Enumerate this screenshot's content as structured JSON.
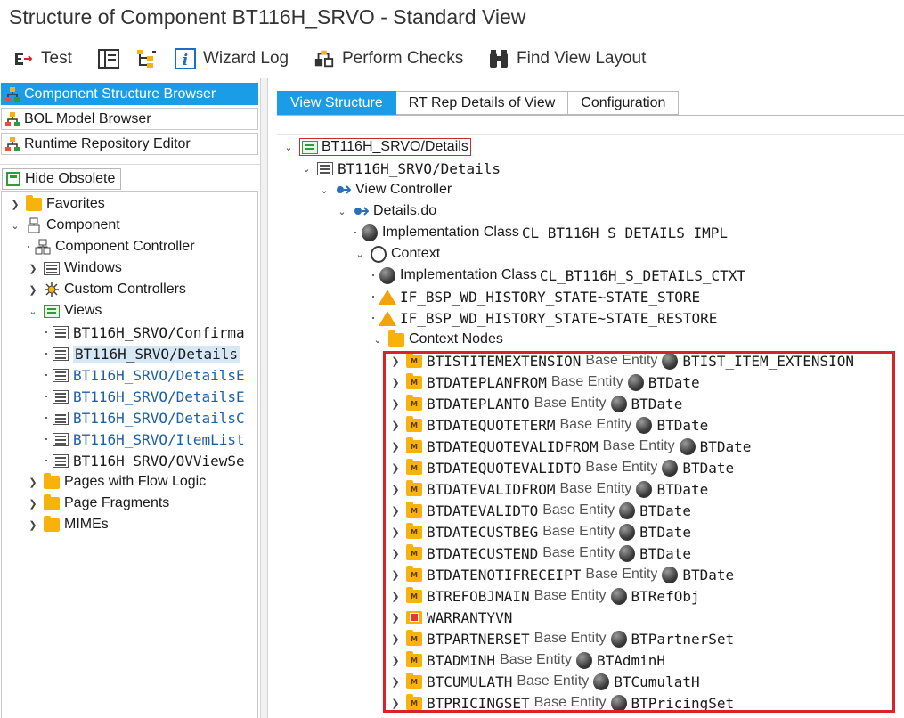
{
  "window": {
    "title": "Structure of Component BT116H_SRVO - Standard View"
  },
  "toolbar": {
    "test_label": "Test",
    "wizard_log_label": "Wizard Log",
    "perform_checks_label": "Perform Checks",
    "find_view_layout_label": "Find View Layout"
  },
  "left_panel": {
    "browsers": [
      {
        "label": "Component Structure Browser"
      },
      {
        "label": "BOL Model Browser"
      },
      {
        "label": "Runtime Repository Editor"
      }
    ],
    "hide_obsolete_label": "Hide Obsolete",
    "tree": {
      "favorites": "Favorites",
      "component": "Component",
      "component_controller": "Component Controller",
      "windows": "Windows",
      "custom_controllers": "Custom Controllers",
      "views": "Views",
      "view_items": [
        "BT116H_SRVO/Confirma",
        "BT116H_SRVO/Details",
        "BT116H_SRVO/DetailsE",
        "BT116H_SRVO/DetailsE",
        "BT116H_SRVO/DetailsC",
        "BT116H_SRVO/ItemList",
        "BT116H_SRVO/OVViewSe"
      ],
      "pages_with_flow_logic": "Pages with Flow Logic",
      "page_fragments": "Page Fragments",
      "mimes": "MIMEs"
    }
  },
  "tabs": [
    {
      "label": "View Structure"
    },
    {
      "label": "RT Rep Details of View"
    },
    {
      "label": "Configuration"
    }
  ],
  "view_structure": {
    "root": "BT116H_SRVO/Details",
    "view": "BT116H_SRVO/Details",
    "view_controller": "View Controller",
    "details_do": "Details.do",
    "impl_class_label": "Implementation Class",
    "impl_class_value": "CL_BT116H_S_DETAILS_IMPL",
    "context": "Context",
    "ctx_impl_class_label": "Implementation Class",
    "ctx_impl_class_value": "CL_BT116H_S_DETAILS_CTXT",
    "history_store": "IF_BSP_WD_HISTORY_STATE~STATE_STORE",
    "history_restore": "IF_BSP_WD_HISTORY_STATE~STATE_RESTORE",
    "context_nodes": "Context Nodes",
    "base_entity_label": "Base Entity",
    "nodes": [
      {
        "name": "BTISTITEMEXTENSION",
        "entity": "BTIST_ITEM_EXTENSION",
        "icon": "model-node-icon"
      },
      {
        "name": "BTDATEPLANFROM",
        "entity": "BTDate",
        "icon": "model-node-icon"
      },
      {
        "name": "BTDATEPLANTO",
        "entity": "BTDate",
        "icon": "model-node-icon"
      },
      {
        "name": "BTDATEQUOTETERM",
        "entity": "BTDate",
        "icon": "model-node-icon"
      },
      {
        "name": "BTDATEQUOTEVALIDFROM",
        "entity": "BTDate",
        "icon": "model-node-icon"
      },
      {
        "name": "BTDATEQUOTEVALIDTO",
        "entity": "BTDate",
        "icon": "model-node-icon"
      },
      {
        "name": "BTDATEVALIDFROM",
        "entity": "BTDate",
        "icon": "model-node-icon"
      },
      {
        "name": "BTDATEVALIDTO",
        "entity": "BTDate",
        "icon": "model-node-icon"
      },
      {
        "name": "BTDATECUSTBEG",
        "entity": "BTDate",
        "icon": "model-node-icon"
      },
      {
        "name": "BTDATECUSTEND",
        "entity": "BTDate",
        "icon": "model-node-icon"
      },
      {
        "name": "BTDATENOTIFRECEIPT",
        "entity": "BTDate",
        "icon": "model-node-icon"
      },
      {
        "name": "BTREFOBJMAIN",
        "entity": "BTRefObj",
        "icon": "model-node-icon"
      },
      {
        "name": "WARRANTYVN",
        "entity": "",
        "icon": "value-node-icon"
      },
      {
        "name": "BTPARTNERSET",
        "entity": "BTPartnerSet",
        "icon": "model-node-icon"
      },
      {
        "name": "BTADMINH",
        "entity": "BTAdminH",
        "icon": "model-node-icon"
      },
      {
        "name": "BTCUMULATH",
        "entity": "BTCumulatH",
        "icon": "model-node-icon"
      },
      {
        "name": "BTPRICINGSET",
        "entity": "BTPricingSet",
        "icon": "model-node-icon"
      }
    ]
  },
  "colors": {
    "accent": "#1b9ce6",
    "highlight_border": "#d9232b",
    "folder": "#f7b20c"
  }
}
